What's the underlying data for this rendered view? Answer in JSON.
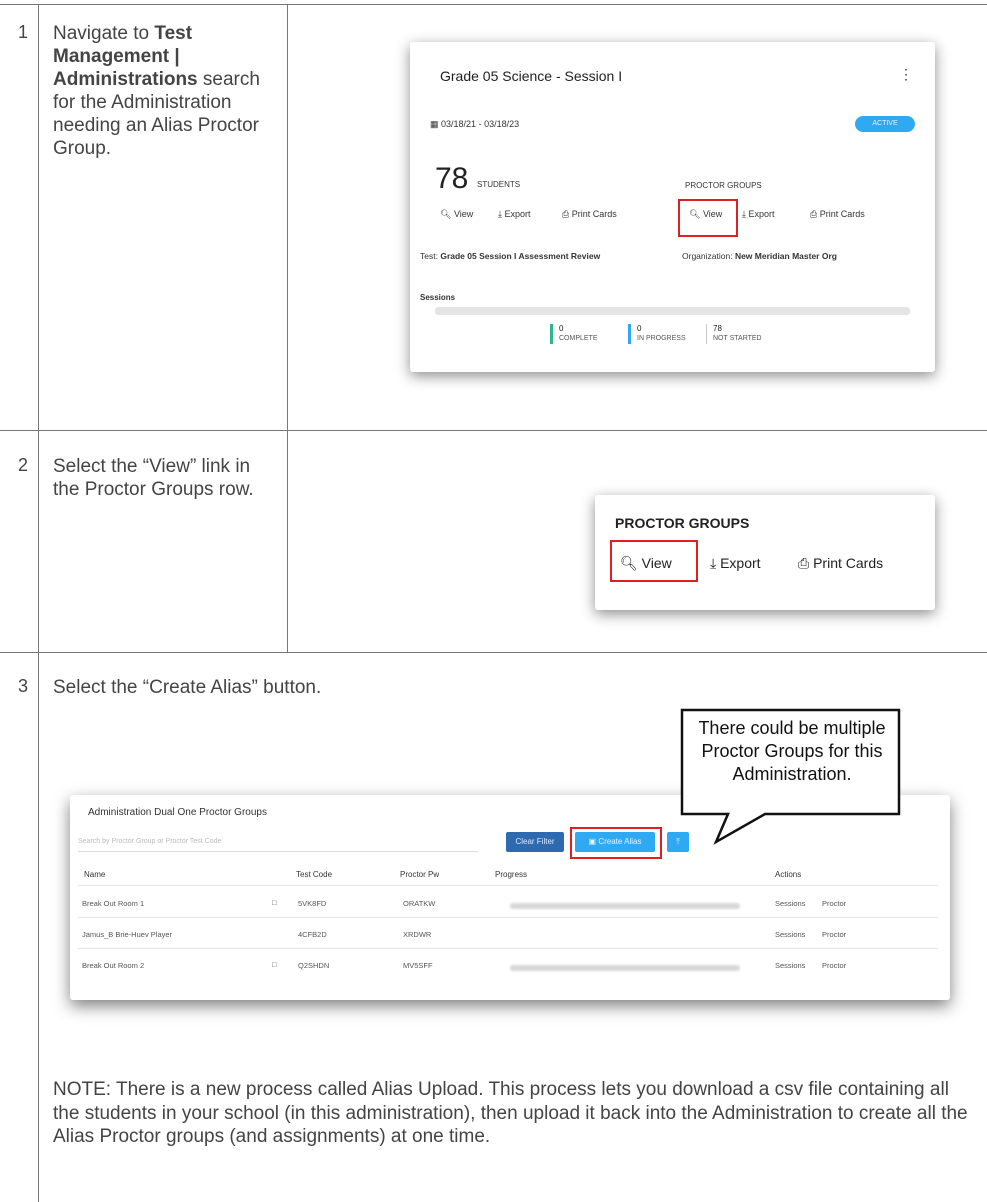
{
  "steps": [
    {
      "number": "1",
      "text_pre": "Navigate to ",
      "text_bold": "Test Management | Administrations",
      "text_post": " search for the Administration needing an Alias Proctor Group."
    },
    {
      "number": "2",
      "text": "Select the “View” link in the Proctor Groups row."
    },
    {
      "number": "3",
      "text": "Select the “Create Alias” button."
    }
  ],
  "card1": {
    "title": "Grade 05 Science - Session I",
    "menu_glyph": "⋮",
    "dates": "03/18/21 - 03/18/23",
    "status": "ACTIVE",
    "students_count": "78",
    "students_label": "STUDENTS",
    "proctor_groups_label": "PROCTOR GROUPS",
    "links": {
      "view": "View",
      "export": "Export",
      "print": "Print Cards"
    },
    "test_label": "Test:",
    "test_value": "Grade 05 Session I Assessment Review",
    "org_label": "Organization:",
    "org_value": "New Meridian Master Org",
    "sessions_label": "Sessions",
    "stats": [
      {
        "value": "0",
        "label": "COMPLETE",
        "color": "#2fb58b"
      },
      {
        "value": "0",
        "label": "IN PROGRESS",
        "color": "#2ea9f2"
      },
      {
        "value": "78",
        "label": "NOT STARTED",
        "color": "#cccccc"
      }
    ]
  },
  "card2": {
    "heading": "PROCTOR GROUPS",
    "view": "View",
    "export": "Export",
    "print": "Print Cards"
  },
  "card3": {
    "title": "Administration Dual One Proctor Groups",
    "search_placeholder": "Search by Proctor Group or Proctor Test Code",
    "clear_filter": "Clear Filter",
    "create_alias": "Create Alias",
    "columns": [
      "Name",
      "Test Code",
      "Proctor Pw",
      "Progress",
      "Actions"
    ],
    "rows": [
      {
        "name": "Break Out Room 1",
        "code": "5VK8FD",
        "pw": "ORATKW",
        "a1": "Sessions",
        "a2": "Proctor"
      },
      {
        "name": "Jamus_B Brie-Huev Player",
        "code": "4CFB2D",
        "pw": "XRDWR",
        "a1": "Sessions",
        "a2": "Proctor"
      },
      {
        "name": "Break Out Room 2",
        "code": "Q2SHDN",
        "pw": "MV5SFF",
        "a1": "Sessions",
        "a2": "Proctor"
      }
    ]
  },
  "callout": "There could be multiple Proctor Groups for this Administration.",
  "note": "NOTE:  There is a new process called Alias Upload. This process lets you download a csv file containing all the students in your school (in this administration), then upload it back into the Administration to create all the Alias Proctor groups (and assignments) at one time.",
  "colors": {
    "highlight": "#e02020",
    "accent": "#2ea9f2",
    "dark_button": "#2d6ab0"
  }
}
